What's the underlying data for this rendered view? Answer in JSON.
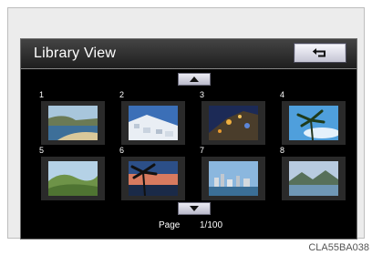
{
  "header": {
    "title": "Library View"
  },
  "thumbnails": [
    {
      "number": "1",
      "scene": "beach-cove"
    },
    {
      "number": "2",
      "scene": "hillside-village"
    },
    {
      "number": "3",
      "scene": "night-city"
    },
    {
      "number": "4",
      "scene": "palm-sky"
    },
    {
      "number": "5",
      "scene": "green-hills"
    },
    {
      "number": "6",
      "scene": "sunset-palm"
    },
    {
      "number": "7",
      "scene": "city-skyline"
    },
    {
      "number": "8",
      "scene": "lake-mountains"
    }
  ],
  "pagination": {
    "label": "Page",
    "value": "1/100"
  },
  "figure_code": "CLA55BA038",
  "icons": {
    "back": "return-arrow-icon",
    "up": "up-triangle-icon",
    "down": "down-triangle-icon"
  },
  "colors": {
    "screen_bg": "#000000",
    "button_face": "#e2e2ec"
  }
}
